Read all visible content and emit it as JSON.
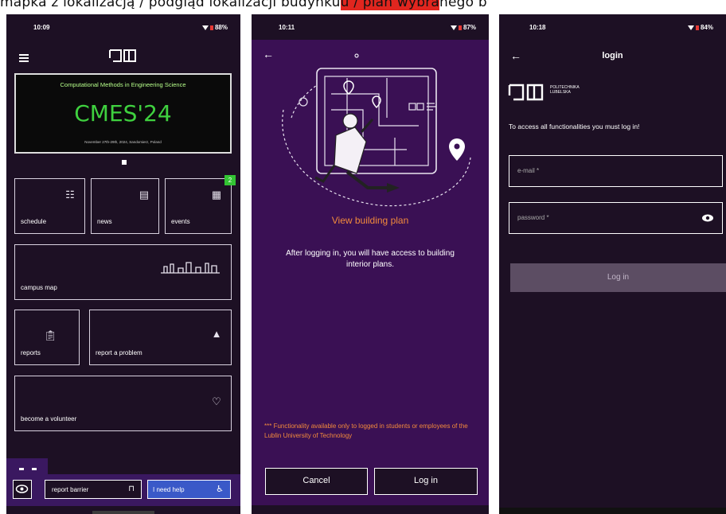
{
  "caption": {
    "text_before": "mapka z lokalizacją / podgląd lokalizacji budynku",
    "text_highlight": "u / plan wybra",
    "text_after": "nego b"
  },
  "phone1": {
    "time": "10:09",
    "battery": "88%",
    "logo": "[]]",
    "banner": {
      "title": "Computational Methods in Engineering Science",
      "main": "CMES'24",
      "date": "November 27th-29th, 2024, Sandomierz, Poland"
    },
    "tiles": {
      "schedule": "schedule",
      "news": "news",
      "events": "events",
      "events_badge": "2",
      "campus_map": "campus map",
      "reports": "reports",
      "report_problem": "report a problem",
      "volunteer": "become a volunteer"
    },
    "bottom": {
      "report_barrier": "report barrier",
      "need_help": "I need help"
    }
  },
  "phone2": {
    "time": "10:11",
    "battery": "87%",
    "heading": "View building plan",
    "body": "After logging in, you will have access to building interior plans.",
    "note": "*** Functionality available only to logged in students or employees of the Lublin University of Technology",
    "cancel": "Cancel",
    "login": "Log in"
  },
  "phone3": {
    "time": "10:18",
    "battery": "84%",
    "title": "login",
    "logo_text": "POLITECHNIKA LUBELSKA",
    "message": "To access all functionalities you must log in!",
    "email_placeholder": "e-mail *",
    "password_placeholder": "password *",
    "login_button": "Log in"
  },
  "colors": {
    "dark_bg": "#1d1024",
    "purple_bg": "#3a1054",
    "accent_orange": "#f28a3c",
    "accent_green": "#3fd13f",
    "accent_blue": "#3a59c8"
  }
}
